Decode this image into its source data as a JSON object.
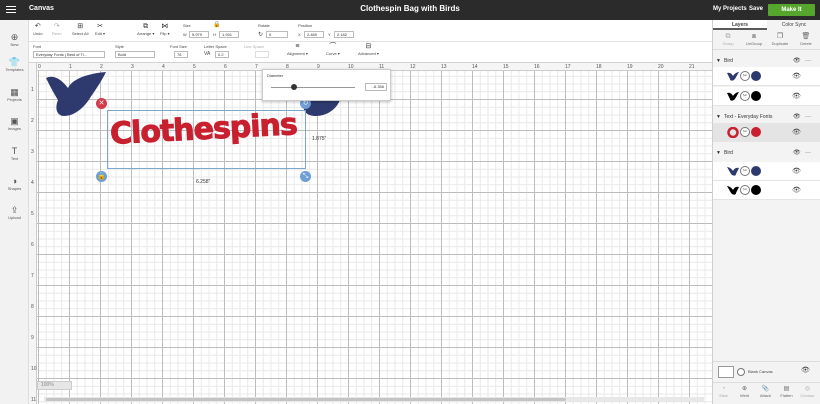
{
  "topbar": {
    "app_title": "Canvas",
    "document_title": "Clothespin Bag with Birds",
    "my_projects": "My Projects",
    "save": "Save",
    "make_it": "Make It"
  },
  "toolbar1": {
    "undo": "Undo",
    "redo": "Redo",
    "select_all": "Select All",
    "edit": "Edit",
    "arrange": "Arrange",
    "flip": "Flip",
    "size_label": "Size",
    "w_prefix": "W",
    "w_value": "5.979",
    "h_prefix": "H",
    "h_value": "1.931",
    "rotate_label": "Rotate",
    "rotate_value": "0",
    "position_label": "Position",
    "x_prefix": "X",
    "x_value": "2.469",
    "y_prefix": "Y",
    "y_value": "2.182"
  },
  "toolbar2": {
    "font_label": "Font",
    "font_value": "Everyday Fonts | Best of Ti...",
    "style_label": "Style",
    "style_value": "Bold",
    "font_size_label": "Font Size",
    "font_size_value": "76",
    "letter_space_label": "Letter Space",
    "letter_space_value": "0.2",
    "line_space_label": "Line Space",
    "alignment": "Alignment",
    "curve": "Curve",
    "advanced": "Advanced"
  },
  "sidebar": {
    "items": [
      {
        "label": "New",
        "icon": "plus-icon"
      },
      {
        "label": "Templates",
        "icon": "shirt-icon"
      },
      {
        "label": "Projects",
        "icon": "projects-icon"
      },
      {
        "label": "Images",
        "icon": "image-icon"
      },
      {
        "label": "Text",
        "icon": "text-icon"
      },
      {
        "label": "Shapes",
        "icon": "shapes-icon"
      },
      {
        "label": "Upload",
        "icon": "upload-icon"
      }
    ]
  },
  "ruler": {
    "top": [
      "0",
      "1",
      "2",
      "3",
      "4",
      "5",
      "6",
      "7",
      "8",
      "9",
      "10",
      "11",
      "12",
      "13",
      "14",
      "15",
      "16",
      "17",
      "18",
      "19",
      "20",
      "21"
    ],
    "left": [
      "1",
      "2",
      "3",
      "4",
      "5",
      "6",
      "7",
      "8",
      "9",
      "10",
      "11"
    ]
  },
  "design": {
    "text": "Clothespins",
    "width_label": "6.258\"",
    "height_label": "1.875\""
  },
  "curve_popup": {
    "title": "Diameter",
    "value": "-6.356",
    "slider_position": 0.28
  },
  "zoom": {
    "label": "100%"
  },
  "layers_panel": {
    "tabs": [
      "Layers",
      "Color Sync"
    ],
    "actions": [
      "Group",
      "UnGroup",
      "Duplicate",
      "Delete"
    ],
    "groups": [
      {
        "name": "Bird",
        "layer_colors": [
          "#2e3a6e",
          "#000000"
        ]
      },
      {
        "name": "Text - Everyday Fonts",
        "layer_colors": [
          "#c8202f"
        ]
      },
      {
        "name": "Bird",
        "layer_colors": [
          "#2e3a6e",
          "#000000"
        ]
      }
    ],
    "blank_canvas": "Blank Canvas",
    "bottom_actions": [
      "Slice",
      "Weld",
      "Attach",
      "Flatten",
      "Contour"
    ]
  },
  "colors": {
    "accent_green": "#56a52d",
    "bird_navy": "#2e3a6e",
    "text_red": "#c8202f",
    "topbar_dark": "#2b2b2b"
  }
}
